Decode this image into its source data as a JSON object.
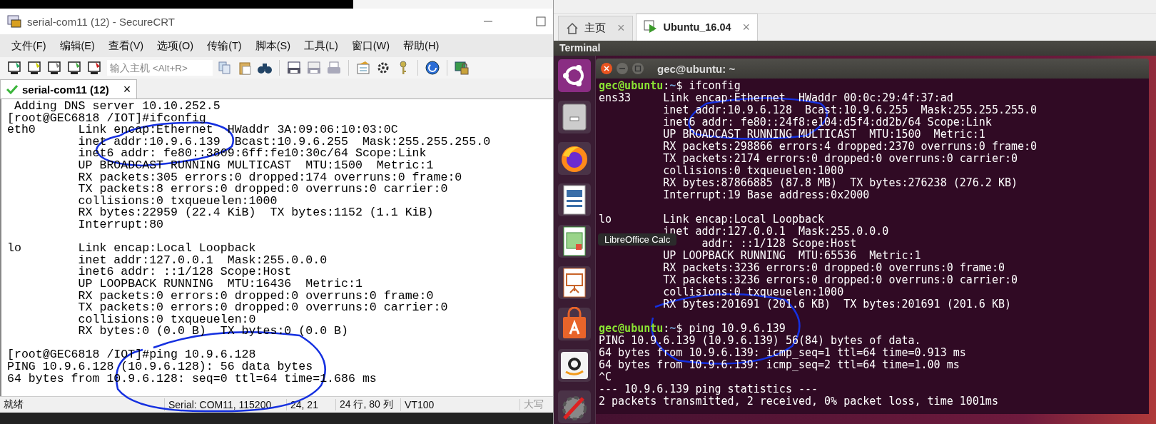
{
  "securecrt": {
    "title": "serial-com11 (12) - SecureCRT",
    "menu": [
      "文件(F)",
      "编辑(E)",
      "查看(V)",
      "选项(O)",
      "传输(T)",
      "脚本(S)",
      "工具(L)",
      "窗口(W)",
      "帮助(H)"
    ],
    "host_field": {
      "placeholder": "输入主机 <Alt+R>"
    },
    "tab": {
      "label": "serial-com11 (12)",
      "selected": true,
      "close": "×"
    },
    "terminal": {
      "blocks": [
        [
          " Adding DNS server 10.10.252.5",
          "[root@GEC6818 /IOT]#ifconfig",
          "eth0      Link encap:Ethernet  HWaddr 3A:09:06:10:03:0C",
          "          inet addr:10.9.6.139  Bcast:10.9.6.255  Mask:255.255.255.0",
          "          inet6 addr: fe80::3809:6ff:fe10:30c/64 Scope:Link",
          "          UP BROADCAST RUNNING MULTICAST  MTU:1500  Metric:1",
          "          RX packets:305 errors:0 dropped:174 overruns:0 frame:0",
          "          TX packets:8 errors:0 dropped:0 overruns:0 carrier:0",
          "          collisions:0 txqueuelen:1000",
          "          RX bytes:22959 (22.4 KiB)  TX bytes:1152 (1.1 KiB)",
          "          Interrupt:80"
        ],
        [
          "lo        Link encap:Local Loopback",
          "          inet addr:127.0.0.1  Mask:255.0.0.0",
          "          inet6 addr: ::1/128 Scope:Host",
          "          UP LOOPBACK RUNNING  MTU:16436  Metric:1",
          "          RX packets:0 errors:0 dropped:0 overruns:0 frame:0",
          "          TX packets:0 errors:0 dropped:0 overruns:0 carrier:0",
          "          collisions:0 txqueuelen:0",
          "          RX bytes:0 (0.0 B)  TX bytes:0 (0.0 B)"
        ],
        [
          "[root@GEC6818 /IOT]#ping 10.9.6.128",
          "PING 10.9.6.128 (10.9.6.128): 56 data bytes",
          "64 bytes from 10.9.6.128: seq=0 ttl=64 time=1.686 ms"
        ]
      ]
    },
    "status_bar": [
      "就绪",
      "Serial: COM11, 115200",
      "24,  21",
      "24 行, 80 列",
      "VT100",
      "大写"
    ]
  },
  "vmware": {
    "tabs": [
      {
        "kind": "home",
        "label": "主页",
        "selected": false,
        "close": "×"
      },
      {
        "kind": "vm",
        "label": "Ubuntu_16.04",
        "selected": true,
        "close": "×"
      }
    ],
    "view_title": "Terminal",
    "launcher_tooltip": "LibreOffice Calc",
    "terminal": {
      "title": "gec@ubuntu: ~",
      "blocks": [
        [
          {
            "kind": "prompt",
            "user": "gec@ubuntu",
            "colon": ":",
            "path": "~",
            "command": "$ ifconfig"
          },
          {
            "kind": "output",
            "text": "ens33     Link encap:Ethernet  HWaddr 00:0c:29:4f:37:ad"
          },
          {
            "kind": "output",
            "text": "          inet addr:10.9.6.128  Bcast:10.9.6.255  Mask:255.255.255.0"
          },
          {
            "kind": "output",
            "text": "          inet6 addr: fe80::24f8:e104:d5f4:dd2b/64 Scope:Link"
          },
          {
            "kind": "output",
            "text": "          UP BROADCAST RUNNING MULTICAST  MTU:1500  Metric:1"
          },
          {
            "kind": "output",
            "text": "          RX packets:298866 errors:4 dropped:2370 overruns:0 frame:0"
          },
          {
            "kind": "output",
            "text": "          TX packets:2174 errors:0 dropped:0 overruns:0 carrier:0"
          },
          {
            "kind": "output",
            "text": "          collisions:0 txqueuelen:1000"
          },
          {
            "kind": "output",
            "text": "          RX bytes:87866885 (87.8 MB)  TX bytes:276238 (276.2 KB)"
          },
          {
            "kind": "output",
            "text": "          Interrupt:19 Base address:0x2000"
          }
        ],
        [
          {
            "kind": "output",
            "text": "lo        Link encap:Local Loopback"
          },
          {
            "kind": "output",
            "text": "          inet addr:127.0.0.1  Mask:255.0.0.0"
          },
          {
            "kind": "covered",
            "text": "addr: ::1/128 Scope:Host"
          },
          {
            "kind": "output",
            "text": "          UP LOOPBACK RUNNING  MTU:65536  Metric:1"
          },
          {
            "kind": "output",
            "text": "          RX packets:3236 errors:0 dropped:0 overruns:0 frame:0"
          },
          {
            "kind": "output",
            "text": "          TX packets:3236 errors:0 dropped:0 overruns:0 carrier:0"
          },
          {
            "kind": "output",
            "text": "          collisions:0 txqueuelen:1000"
          },
          {
            "kind": "output",
            "text": "          RX bytes:201691 (201.6 KB)  TX bytes:201691 (201.6 KB)"
          }
        ],
        [
          {
            "kind": "prompt",
            "user": "gec@ubuntu",
            "colon": ":",
            "path": "~",
            "command": "$ ping 10.9.6.139"
          },
          {
            "kind": "output",
            "text": "PING 10.9.6.139 (10.9.6.139) 56(84) bytes of data."
          },
          {
            "kind": "output",
            "text": "64 bytes from 10.9.6.139: icmp_seq=1 ttl=64 time=0.913 ms"
          },
          {
            "kind": "output",
            "text": "64 bytes from 10.9.6.139: icmp_seq=2 ttl=64 time=1.00 ms"
          },
          {
            "kind": "output",
            "text": "^C"
          },
          {
            "kind": "output",
            "text": "--- 10.9.6.139 ping statistics ---"
          },
          {
            "kind": "output",
            "text": "2 packets transmitted, 2 received, 0% packet loss, time 1001ms"
          }
        ]
      ]
    }
  }
}
